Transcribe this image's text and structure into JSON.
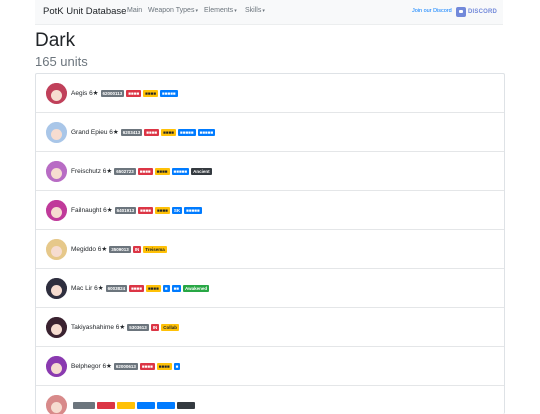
{
  "navbar": {
    "brand": "PotK Unit Database",
    "links": [
      {
        "label": "Main"
      },
      {
        "label": "Weapon Types"
      },
      {
        "label": "Elements"
      },
      {
        "label": "Skills"
      }
    ],
    "join_text": "Join our Discord",
    "discord_label": "DISCORD"
  },
  "page": {
    "title": "Dark",
    "subtitle": "165 units"
  },
  "colors": {
    "badge_id": "#6c757d",
    "badge_red": "#dc3545",
    "badge_yellow": "#ffc107",
    "badge_blue": "#007bff",
    "badge_dark": "#343a40",
    "badge_green": "#28a745"
  },
  "units": [
    {
      "name": "Aegis 6★",
      "avatar_color": "#c0405a",
      "badges": [
        {
          "text": "62000113",
          "kind": "id"
        },
        {
          "text": "■■■■",
          "kind": "red"
        },
        {
          "text": "■■■■",
          "kind": "yellow"
        },
        {
          "text": "■■■■■",
          "kind": "blue"
        }
      ]
    },
    {
      "name": "Grand Epieu 6★",
      "avatar_color": "#a9c6e8",
      "badges": [
        {
          "text": "6203413",
          "kind": "id"
        },
        {
          "text": "■■■■",
          "kind": "red"
        },
        {
          "text": "■■■■",
          "kind": "yellow"
        },
        {
          "text": "■■■■■",
          "kind": "blue"
        },
        {
          "text": "■■■■■",
          "kind": "blue"
        }
      ]
    },
    {
      "name": "Freischutz 6★",
      "avatar_color": "#b86cc4",
      "badges": [
        {
          "text": "6502723",
          "kind": "id"
        },
        {
          "text": "■■■■",
          "kind": "red"
        },
        {
          "text": "■■■■",
          "kind": "yellow"
        },
        {
          "text": "■■■■■",
          "kind": "blue"
        },
        {
          "text": "Ancient",
          "kind": "dark"
        }
      ]
    },
    {
      "name": "Failnaught 6★",
      "avatar_color": "#c03a9a",
      "badges": [
        {
          "text": "6401913",
          "kind": "id"
        },
        {
          "text": "■■■■",
          "kind": "red"
        },
        {
          "text": "■■■■",
          "kind": "yellow"
        },
        {
          "text": "SK",
          "kind": "blue"
        },
        {
          "text": "■■■■■",
          "kind": "blue"
        }
      ]
    },
    {
      "name": "Megiddo 6★",
      "avatar_color": "#e6c88a",
      "badges": [
        {
          "text": "3509013",
          "kind": "id"
        },
        {
          "text": "IN",
          "kind": "red"
        },
        {
          "text": "Treisema",
          "kind": "yellow"
        }
      ]
    },
    {
      "name": "Mac Lir 6★",
      "avatar_color": "#2e2e3e",
      "badges": [
        {
          "text": "6003824",
          "kind": "id"
        },
        {
          "text": "■■■■",
          "kind": "red"
        },
        {
          "text": "■■■■",
          "kind": "yellow"
        },
        {
          "text": "■",
          "kind": "blue"
        },
        {
          "text": "■■",
          "kind": "blue"
        },
        {
          "text": "Awakened",
          "kind": "green"
        }
      ]
    },
    {
      "name": "Takiyashahime 6★",
      "avatar_color": "#3a2230",
      "badges": [
        {
          "text": "5303613",
          "kind": "id"
        },
        {
          "text": "IN",
          "kind": "red"
        },
        {
          "text": "Collab",
          "kind": "yellow"
        }
      ]
    },
    {
      "name": "Belphegor 6★",
      "avatar_color": "#8a3ab0",
      "badges": [
        {
          "text": "62000613",
          "kind": "id"
        },
        {
          "text": "■■■■",
          "kind": "red"
        },
        {
          "text": "■■■■",
          "kind": "yellow"
        },
        {
          "text": "■",
          "kind": "blue"
        }
      ]
    },
    {
      "name": "",
      "avatar_color": "#d88a8a",
      "badges": [
        {
          "text": "",
          "kind": "id"
        },
        {
          "text": "",
          "kind": "red"
        },
        {
          "text": "",
          "kind": "yellow"
        },
        {
          "text": "",
          "kind": "blue"
        },
        {
          "text": "",
          "kind": "blue"
        },
        {
          "text": "",
          "kind": "dark"
        }
      ]
    }
  ]
}
